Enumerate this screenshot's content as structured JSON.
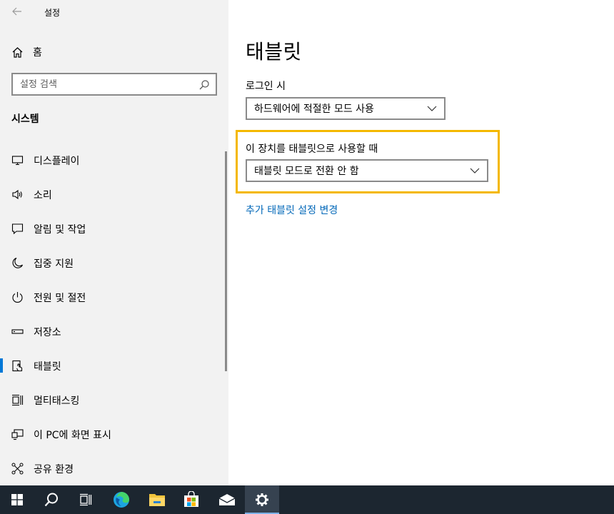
{
  "app": {
    "title": "설정"
  },
  "home": {
    "label": "홈"
  },
  "search": {
    "placeholder": "설정 검색"
  },
  "section": {
    "title": "시스템"
  },
  "nav": {
    "items": [
      {
        "label": "디스플레이",
        "icon": "display-icon"
      },
      {
        "label": "소리",
        "icon": "speaker-icon"
      },
      {
        "label": "알림 및 작업",
        "icon": "notification-icon"
      },
      {
        "label": "집중 지원",
        "icon": "moon-icon"
      },
      {
        "label": "전원 및 절전",
        "icon": "power-icon"
      },
      {
        "label": "저장소",
        "icon": "storage-icon"
      },
      {
        "label": "태블릿",
        "icon": "tablet-icon",
        "active": true
      },
      {
        "label": "멀티태스킹",
        "icon": "multitasking-icon"
      },
      {
        "label": "이 PC에 화면 표시",
        "icon": "project-icon"
      },
      {
        "label": "공유 환경",
        "icon": "share-icon"
      }
    ]
  },
  "main": {
    "title": "태블릿",
    "signin_label": "로그인 시",
    "signin_value": "하드웨어에 적절한 모드 사용",
    "tablet_use_label": "이 장치를 태블릿으로 사용할 때",
    "tablet_use_value": "태블릿 모드로 전환 안 함",
    "more_link": "추가 태블릿 설정 변경"
  },
  "colors": {
    "accent": "#0078d7",
    "link": "#0067b8",
    "highlight": "#f4b800",
    "sidebar_bg": "#f2f2f2",
    "taskbar_bg": "#1c2630"
  },
  "taskbar": {
    "icons": [
      "start-icon",
      "search-icon",
      "task-view-icon",
      "edge-icon",
      "file-explorer-icon",
      "store-icon",
      "mail-icon",
      "settings-icon"
    ]
  }
}
